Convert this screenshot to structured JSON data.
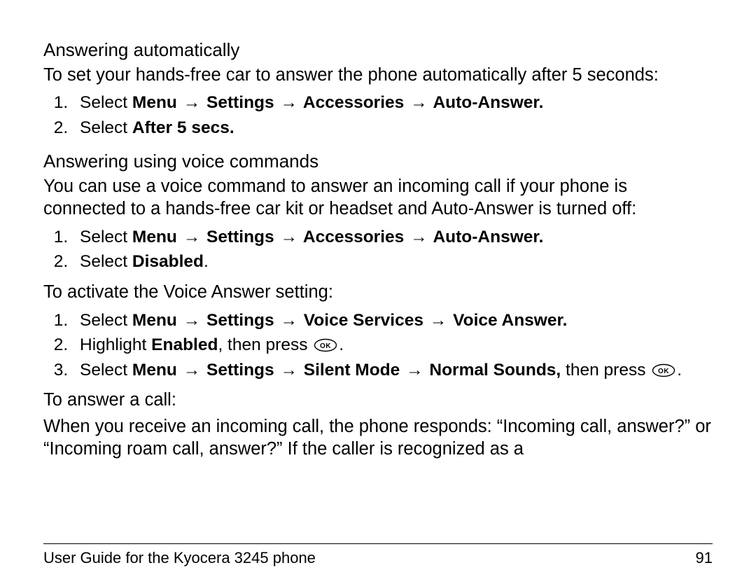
{
  "section1": {
    "title": "Answering automatically",
    "intro": "To set your hands-free car to answer the phone automatically after 5 seconds:",
    "steps": {
      "s1_pre": "Select ",
      "s1_path": [
        "Menu",
        "Settings",
        "Accessories",
        "Auto-Answer."
      ],
      "s2_pre": "Select ",
      "s2_bold": "After 5 secs."
    }
  },
  "section2": {
    "title": "Answering using voice commands",
    "intro": "You can use a voice command to answer an incoming call if your phone is connected to a hands-free car kit or headset and Auto-Answer is turned off:",
    "stepsA": {
      "s1_pre": "Select ",
      "s1_path": [
        "Menu",
        "Settings",
        "Accessories",
        "Auto-Answer."
      ],
      "s2_pre": "Select ",
      "s2_bold": "Disabled",
      "s2_post": "."
    },
    "activate": "To activate the Voice Answer setting:",
    "stepsB": {
      "s1_pre": "Select ",
      "s1_path": [
        "Menu",
        "Settings",
        "Voice Services",
        "Voice Answer."
      ],
      "s2_pre": "Highlight ",
      "s2_bold": "Enabled",
      "s2_mid": ", then press ",
      "s2_post": ".",
      "s3_pre": "Select ",
      "s3_path": [
        "Menu",
        "Settings",
        "Silent Mode",
        "Normal Sounds,"
      ],
      "s3_mid": " then press ",
      "s3_post": "."
    },
    "answer_title": "To answer a call:",
    "answer_body": "When you receive an incoming call, the phone responds: “Incoming call, answer?” or “Incoming roam call, answer?” If the caller is recognized as a"
  },
  "arrow": "→",
  "footer": {
    "left": "User Guide for the Kyocera 3245 phone",
    "right": "91"
  }
}
